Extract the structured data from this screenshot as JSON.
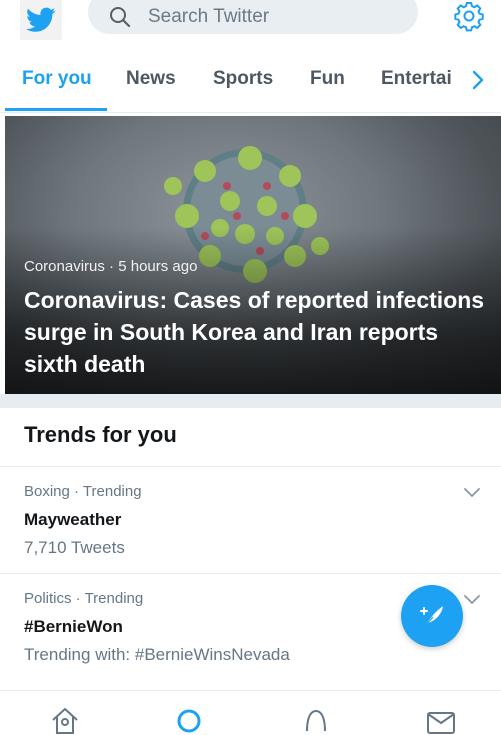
{
  "header": {
    "search_placeholder": "Search Twitter",
    "icons": {
      "logo": "twitter-bird-icon",
      "search": "search-icon",
      "settings": "gear-icon"
    }
  },
  "tabs": [
    {
      "label": "For you",
      "active": true
    },
    {
      "label": "News",
      "active": false
    },
    {
      "label": "Sports",
      "active": false
    },
    {
      "label": "Fun",
      "active": false
    },
    {
      "label": "Entertai",
      "active": false
    }
  ],
  "hero": {
    "category": "Coronavirus",
    "time": "5 hours ago",
    "title": "Coronavirus: Cases of reported infections surge in South Korea and Iran reports sixth death"
  },
  "trends": {
    "heading": "Trends for you",
    "items": [
      {
        "category": "Boxing · Trending",
        "name": "Mayweather",
        "sub": "7,710 Tweets"
      },
      {
        "category": "Politics · Trending",
        "name": "#BernieWon",
        "sub": "Trending with: #BernieWinsNevada"
      }
    ]
  },
  "bottom_nav": [
    "home-icon",
    "search-icon",
    "notifications-icon",
    "messages-icon"
  ],
  "colors": {
    "accent": "#1da1f2",
    "text": "#14171a",
    "muted": "#657786",
    "divider": "#e6ecf0"
  }
}
